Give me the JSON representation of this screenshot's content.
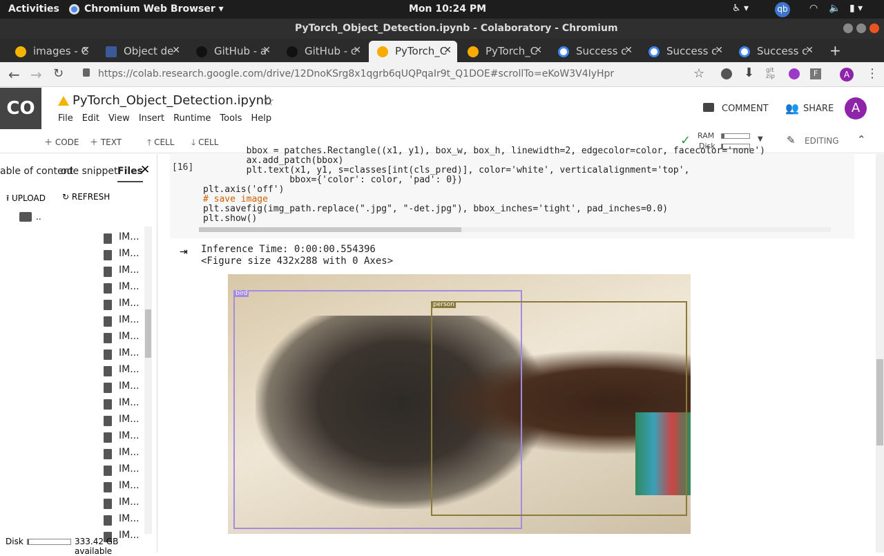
{
  "topbar": {
    "activities": "Activities",
    "app": "Chromium Web Browser",
    "clock": "Mon 10:24 PM",
    "qb": "qb"
  },
  "window": {
    "title": "PyTorch_Object_Detection.ipynb - Colaboratory - Chromium"
  },
  "tabs": [
    {
      "label": "images - C",
      "icon": "drive-icon"
    },
    {
      "label": "Object de",
      "icon": "page-icon"
    },
    {
      "label": "GitHub - a",
      "icon": "github-icon"
    },
    {
      "label": "GitHub - c",
      "icon": "github-icon"
    },
    {
      "label": "PyTorch_C",
      "icon": "colab-icon",
      "active": true
    },
    {
      "label": "PyTorch_C",
      "icon": "colab-icon"
    },
    {
      "label": "Success c",
      "icon": "google-icon"
    },
    {
      "label": "Success c",
      "icon": "google-icon"
    },
    {
      "label": "Success c",
      "icon": "google-icon"
    }
  ],
  "address": {
    "url": "https://colab.research.google.com/drive/12DnoKSrg8x1qgrb6qUQPqaIr9t_Q1DOE#scrollTo=eKoW3V4IyHpr",
    "profile": "A"
  },
  "colab": {
    "logo": "CO",
    "title": "PyTorch_Object_Detection.ipynb",
    "comment": "COMMENT",
    "share": "SHARE",
    "avatar": "A",
    "menus": [
      "File",
      "Edit",
      "View",
      "Insert",
      "Runtime",
      "Tools",
      "Help"
    ]
  },
  "cellbar": {
    "code": "CODE",
    "text": "TEXT",
    "cell_up": "CELL",
    "cell_down": "CELL",
    "ram": "RAM",
    "disk": "Disk",
    "editing": "EDITING"
  },
  "sidebar": {
    "tab_toc": "able of content",
    "tab_snippets": "ode snippet",
    "tab_files": "Files",
    "upload": "UPLOAD",
    "refresh": "REFRESH",
    "parent": "..",
    "items": [
      "IM...",
      "IM...",
      "IM...",
      "IM...",
      "IM...",
      "IM...",
      "IM...",
      "IM...",
      "IM...",
      "IM...",
      "IM...",
      "IM...",
      "IM...",
      "IM...",
      "IM...",
      "IM...",
      "IM...",
      "IM...",
      "IM..."
    ],
    "disk_label": "Disk",
    "disk_free": "333.42 GB available"
  },
  "cell": {
    "number": "[16]",
    "lines": [
      "        bbox = patches.Rectangle((x1, y1), box_w, box_h, linewidth=2, edgecolor=color, facecolor='none')",
      "        ax.add_patch(bbox)",
      "        plt.text(x1, y1, s=classes[int(cls_pred)], color='white', verticalalignment='top',",
      "                bbox={'color': color, 'pad': 0})",
      "plt.axis('off')",
      "# save image",
      "plt.savefig(img_path.replace(\".jpg\", \"-det.jpg\"), bbox_inches='tight', pad_inches=0.0)",
      "plt.show()"
    ]
  },
  "output": {
    "line1": "Inference Time: 0:00:00.554396",
    "line2": "<Figure size 432x288 with 0 Axes>"
  },
  "detections": [
    {
      "label": "bird",
      "color": "#a48ae0"
    },
    {
      "label": "person",
      "color": "#8a7a3a"
    }
  ]
}
